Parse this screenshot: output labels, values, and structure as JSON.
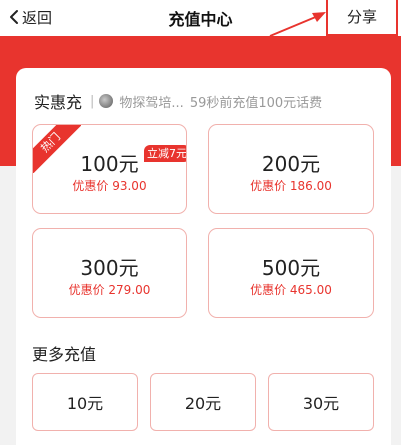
{
  "nav": {
    "back_label": "返回",
    "title": "充值中心",
    "share_label": "分享"
  },
  "promo": {
    "title": "实惠充",
    "user": "物探驾培...",
    "message": "59秒前充值100元话费"
  },
  "plans": [
    {
      "amount": "100元",
      "price": "优惠价 93.00",
      "tag": "热门",
      "badge": "立减7元"
    },
    {
      "amount": "200元",
      "price": "优惠价 186.00"
    },
    {
      "amount": "300元",
      "price": "优惠价 279.00"
    },
    {
      "amount": "500元",
      "price": "优惠价 465.00"
    }
  ],
  "more": {
    "title": "更多充值",
    "options": [
      "10元",
      "20元",
      "30元"
    ]
  },
  "colors": {
    "accent": "#e8342e",
    "tile_border": "#f1b1ad",
    "background": "#f2f2f2"
  }
}
